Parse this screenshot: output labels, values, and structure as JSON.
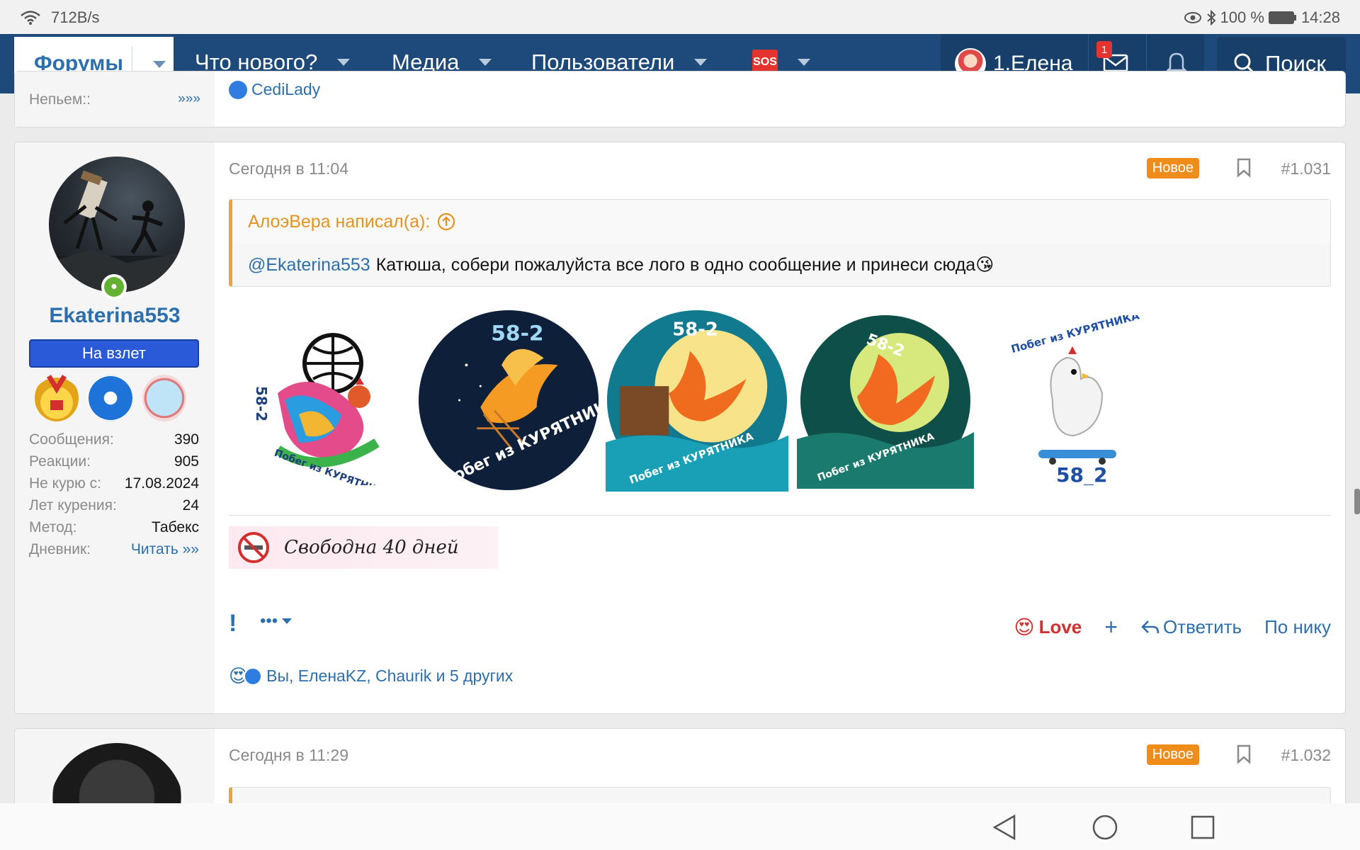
{
  "statusbar": {
    "speed": "712B/s",
    "battery": "100 %",
    "time": "14:28"
  },
  "nav": {
    "forums": "Форумы",
    "whats_new": "Что нового?",
    "media": "Медиа",
    "users": "Пользователи",
    "sos": "SOS",
    "username": "1.Елена",
    "inbox_count": "1",
    "search": "Поиск"
  },
  "prev_post": {
    "field_label": "Непьем::",
    "field_value": "»»»",
    "reaction_text": "СеdiLady"
  },
  "post": {
    "author": "Ekaterina553",
    "user_title": "На взлет",
    "stats": [
      {
        "k": "Сообщения:",
        "v": "390"
      },
      {
        "k": "Реакции:",
        "v": "905"
      },
      {
        "k": "Не курю с:",
        "v": "17.08.2024"
      },
      {
        "k": "Лет курения:",
        "v": "24"
      },
      {
        "k": "Метод:",
        "v": "Табекс"
      },
      {
        "k": "Дневник:",
        "v": "Читать »»"
      }
    ],
    "date": "Сегодня в 11:04",
    "new_badge": "Новое",
    "number": "#1.031",
    "quote_author": "АлоэВера написал(а):",
    "quote_mention": "@Ekaterina553",
    "quote_text": "Катюша, собери пожалуйста все лого в одно сообщение и принеси сюда😘",
    "logos": [
      {
        "top_text": "58-2",
        "bottom_text": "Побег из КУРЯТНИКА"
      },
      {
        "top_text": "58-2",
        "bottom_text": "Побег из КУРЯТНИКА"
      },
      {
        "top_text": "58-2",
        "bottom_text": "Побег из КУРЯТНИКА"
      },
      {
        "top_text": "58-2",
        "bottom_text": "Побег из КУРЯТНИКА"
      },
      {
        "top_text": "Побег из КУРЯТНИКА",
        "bottom_text": "58_2"
      }
    ],
    "signature": "Свободна 40 дней",
    "actions": {
      "more": "•••",
      "love": "Love",
      "plus": "+",
      "reply": "Ответить",
      "bynick": "По нику"
    },
    "reactions_text": "Вы, ЕленаKZ, Chaurik и 5 других"
  },
  "next_post": {
    "date": "Сегодня в 11:29",
    "new_badge": "Новое",
    "number": "#1.032"
  },
  "colors": {
    "nav_bg": "#1d4a7a",
    "link": "#2c6fae",
    "new_badge": "#f08c1a",
    "quote_border": "#f0a23a",
    "love": "#d32f2f"
  }
}
